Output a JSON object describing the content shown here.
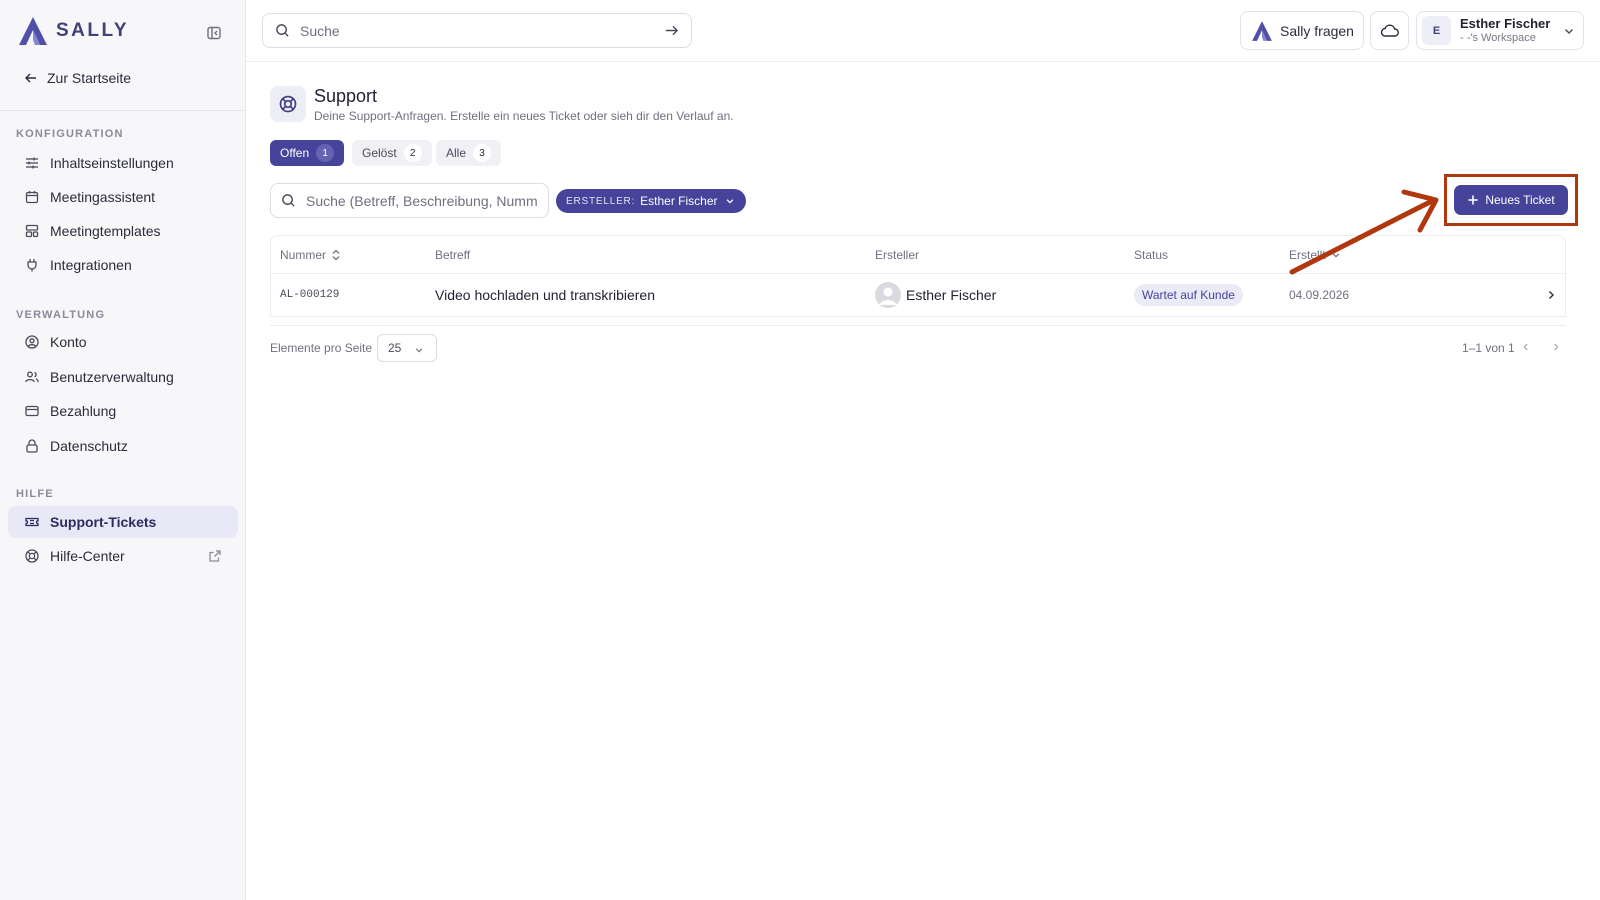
{
  "brand": {
    "name": "SALLY",
    "accent": "#45439a"
  },
  "sidebar": {
    "back_label": "Zur Startseite",
    "sections": [
      {
        "label": "KONFIGURATION",
        "items": [
          {
            "label": "Inhaltseinstellungen",
            "icon": "sliders-icon"
          },
          {
            "label": "Meetingassistent",
            "icon": "calendar-icon"
          },
          {
            "label": "Meetingtemplates",
            "icon": "template-icon"
          },
          {
            "label": "Integrationen",
            "icon": "plug-icon"
          }
        ]
      },
      {
        "label": "VERWALTUNG",
        "items": [
          {
            "label": "Konto",
            "icon": "user-circle-icon"
          },
          {
            "label": "Benutzerverwaltung",
            "icon": "users-icon"
          },
          {
            "label": "Bezahlung",
            "icon": "credit-card-icon"
          },
          {
            "label": "Datenschutz",
            "icon": "lock-icon"
          }
        ]
      },
      {
        "label": "HILFE",
        "items": [
          {
            "label": "Support-Tickets",
            "icon": "ticket-icon",
            "active": true
          },
          {
            "label": "Hilfe-Center",
            "icon": "lifebuoy-icon",
            "external": true
          }
        ]
      }
    ]
  },
  "topbar": {
    "search_placeholder": "Suche",
    "ask_label": "Sally fragen",
    "user": {
      "initial": "E",
      "name": "Esther Fischer",
      "workspace": "- -'s Workspace"
    }
  },
  "page": {
    "title": "Support",
    "subtitle": "Deine Support-Anfragen. Erstelle ein neues Ticket oder sieh dir den Verlauf an.",
    "tabs": [
      {
        "label": "Offen",
        "count": "1",
        "active": true
      },
      {
        "label": "Gelöst",
        "count": "2"
      },
      {
        "label": "Alle",
        "count": "3"
      }
    ],
    "ticket_search_placeholder": "Suche (Betreff, Beschreibung, Nummer)",
    "filter": {
      "key": "ERSTELLER:",
      "value": "Esther Fischer"
    },
    "new_ticket_label": "Neues Ticket",
    "table": {
      "columns": {
        "number": "Nummer",
        "subject": "Betreff",
        "creator": "Ersteller",
        "status": "Status",
        "created": "Erstellt"
      },
      "rows": [
        {
          "number": "AL-000129",
          "subject": "Video hochladen und transkribieren",
          "creator": "Esther Fischer",
          "status": "Wartet auf Kunde",
          "created": "04.09.2026"
        }
      ]
    },
    "pagination": {
      "per_page_label": "Elemente pro Seite",
      "per_page": "25",
      "info": "1–1 von 1"
    }
  },
  "annotation": {
    "color": "#b1380e"
  }
}
